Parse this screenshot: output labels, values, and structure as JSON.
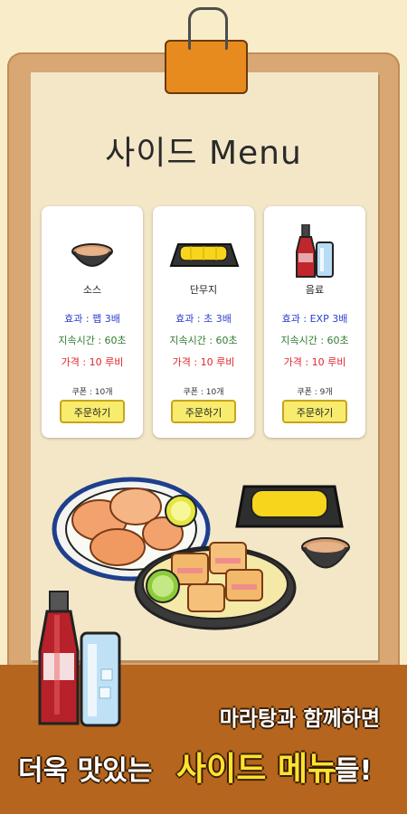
{
  "title": "사이드 Menu",
  "items": [
    {
      "name": "소스",
      "effect": "효과 : 팹 3배",
      "duration": "지속시간 : 60초",
      "price": "가격 : 10 루비",
      "coupon": "쿠폰 : 10개",
      "order_label": "주문하기",
      "icon": "sauce-bowl-icon"
    },
    {
      "name": "단무지",
      "effect": "효과 : 초 3배",
      "duration": "지속시간 : 60초",
      "price": "가격 : 10 루비",
      "coupon": "쿠폰 : 10개",
      "order_label": "주문하기",
      "icon": "pickled-radish-icon"
    },
    {
      "name": "음료",
      "effect": "효과 : EXP 3배",
      "duration": "지속시간 : 60초",
      "price": "가격 : 10 루비",
      "coupon": "쿠폰 : 9개",
      "order_label": "주문하기",
      "icon": "cola-drink-icon"
    }
  ],
  "banner": {
    "line1": "마라탕과 함께하면",
    "line2_start": "더욱 맛있는",
    "line2_highlight": "사이드 메뉴",
    "line2_end": "들!"
  },
  "colors": {
    "effect": "#2b3fd0",
    "duration": "#2f7d2f",
    "price": "#e0242a",
    "button": "#f7ec6e",
    "banner": "#b5651d",
    "highlight": "#ffe22e"
  }
}
